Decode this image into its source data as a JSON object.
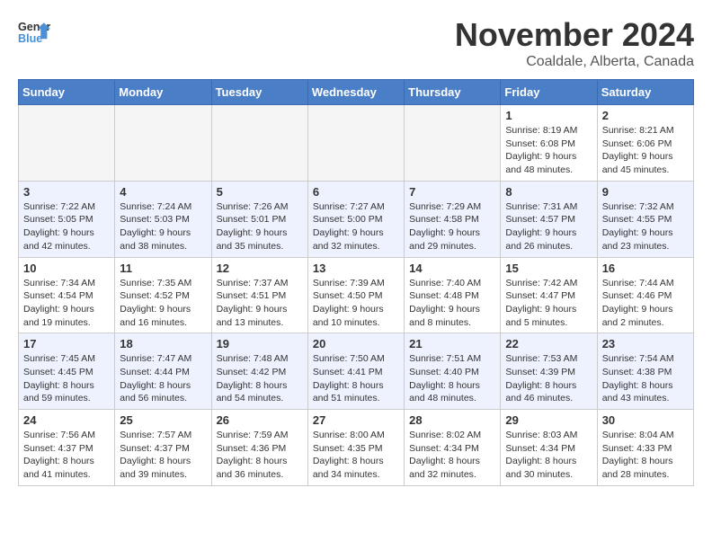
{
  "header": {
    "logo_general": "General",
    "logo_blue": "Blue",
    "month_title": "November 2024",
    "location": "Coaldale, Alberta, Canada"
  },
  "calendar": {
    "weekdays": [
      "Sunday",
      "Monday",
      "Tuesday",
      "Wednesday",
      "Thursday",
      "Friday",
      "Saturday"
    ],
    "weeks": [
      [
        {
          "day": "",
          "info": ""
        },
        {
          "day": "",
          "info": ""
        },
        {
          "day": "",
          "info": ""
        },
        {
          "day": "",
          "info": ""
        },
        {
          "day": "",
          "info": ""
        },
        {
          "day": "1",
          "info": "Sunrise: 8:19 AM\nSunset: 6:08 PM\nDaylight: 9 hours and 48 minutes."
        },
        {
          "day": "2",
          "info": "Sunrise: 8:21 AM\nSunset: 6:06 PM\nDaylight: 9 hours and 45 minutes."
        }
      ],
      [
        {
          "day": "3",
          "info": "Sunrise: 7:22 AM\nSunset: 5:05 PM\nDaylight: 9 hours and 42 minutes."
        },
        {
          "day": "4",
          "info": "Sunrise: 7:24 AM\nSunset: 5:03 PM\nDaylight: 9 hours and 38 minutes."
        },
        {
          "day": "5",
          "info": "Sunrise: 7:26 AM\nSunset: 5:01 PM\nDaylight: 9 hours and 35 minutes."
        },
        {
          "day": "6",
          "info": "Sunrise: 7:27 AM\nSunset: 5:00 PM\nDaylight: 9 hours and 32 minutes."
        },
        {
          "day": "7",
          "info": "Sunrise: 7:29 AM\nSunset: 4:58 PM\nDaylight: 9 hours and 29 minutes."
        },
        {
          "day": "8",
          "info": "Sunrise: 7:31 AM\nSunset: 4:57 PM\nDaylight: 9 hours and 26 minutes."
        },
        {
          "day": "9",
          "info": "Sunrise: 7:32 AM\nSunset: 4:55 PM\nDaylight: 9 hours and 23 minutes."
        }
      ],
      [
        {
          "day": "10",
          "info": "Sunrise: 7:34 AM\nSunset: 4:54 PM\nDaylight: 9 hours and 19 minutes."
        },
        {
          "day": "11",
          "info": "Sunrise: 7:35 AM\nSunset: 4:52 PM\nDaylight: 9 hours and 16 minutes."
        },
        {
          "day": "12",
          "info": "Sunrise: 7:37 AM\nSunset: 4:51 PM\nDaylight: 9 hours and 13 minutes."
        },
        {
          "day": "13",
          "info": "Sunrise: 7:39 AM\nSunset: 4:50 PM\nDaylight: 9 hours and 10 minutes."
        },
        {
          "day": "14",
          "info": "Sunrise: 7:40 AM\nSunset: 4:48 PM\nDaylight: 9 hours and 8 minutes."
        },
        {
          "day": "15",
          "info": "Sunrise: 7:42 AM\nSunset: 4:47 PM\nDaylight: 9 hours and 5 minutes."
        },
        {
          "day": "16",
          "info": "Sunrise: 7:44 AM\nSunset: 4:46 PM\nDaylight: 9 hours and 2 minutes."
        }
      ],
      [
        {
          "day": "17",
          "info": "Sunrise: 7:45 AM\nSunset: 4:45 PM\nDaylight: 8 hours and 59 minutes."
        },
        {
          "day": "18",
          "info": "Sunrise: 7:47 AM\nSunset: 4:44 PM\nDaylight: 8 hours and 56 minutes."
        },
        {
          "day": "19",
          "info": "Sunrise: 7:48 AM\nSunset: 4:42 PM\nDaylight: 8 hours and 54 minutes."
        },
        {
          "day": "20",
          "info": "Sunrise: 7:50 AM\nSunset: 4:41 PM\nDaylight: 8 hours and 51 minutes."
        },
        {
          "day": "21",
          "info": "Sunrise: 7:51 AM\nSunset: 4:40 PM\nDaylight: 8 hours and 48 minutes."
        },
        {
          "day": "22",
          "info": "Sunrise: 7:53 AM\nSunset: 4:39 PM\nDaylight: 8 hours and 46 minutes."
        },
        {
          "day": "23",
          "info": "Sunrise: 7:54 AM\nSunset: 4:38 PM\nDaylight: 8 hours and 43 minutes."
        }
      ],
      [
        {
          "day": "24",
          "info": "Sunrise: 7:56 AM\nSunset: 4:37 PM\nDaylight: 8 hours and 41 minutes."
        },
        {
          "day": "25",
          "info": "Sunrise: 7:57 AM\nSunset: 4:37 PM\nDaylight: 8 hours and 39 minutes."
        },
        {
          "day": "26",
          "info": "Sunrise: 7:59 AM\nSunset: 4:36 PM\nDaylight: 8 hours and 36 minutes."
        },
        {
          "day": "27",
          "info": "Sunrise: 8:00 AM\nSunset: 4:35 PM\nDaylight: 8 hours and 34 minutes."
        },
        {
          "day": "28",
          "info": "Sunrise: 8:02 AM\nSunset: 4:34 PM\nDaylight: 8 hours and 32 minutes."
        },
        {
          "day": "29",
          "info": "Sunrise: 8:03 AM\nSunset: 4:34 PM\nDaylight: 8 hours and 30 minutes."
        },
        {
          "day": "30",
          "info": "Sunrise: 8:04 AM\nSunset: 4:33 PM\nDaylight: 8 hours and 28 minutes."
        }
      ]
    ]
  }
}
